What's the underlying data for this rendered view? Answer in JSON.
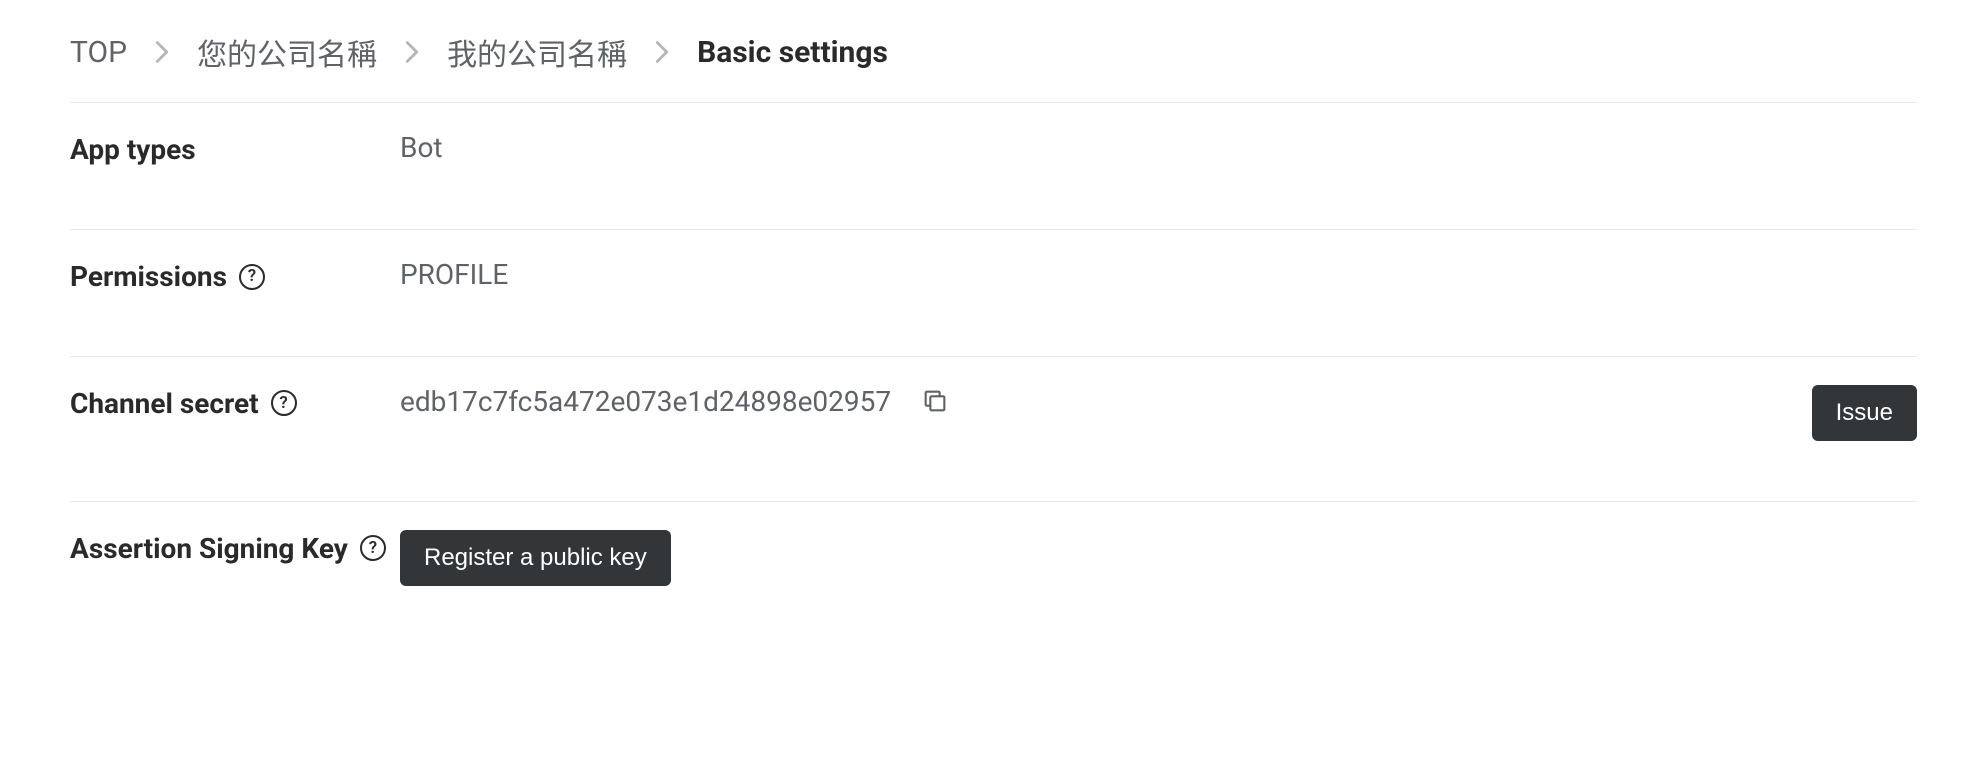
{
  "breadcrumb": {
    "items": [
      {
        "label": "TOP"
      },
      {
        "label": "您的公司名稱"
      },
      {
        "label": "我的公司名稱"
      },
      {
        "label": "Basic settings"
      }
    ]
  },
  "rows": {
    "app_types": {
      "label": "App types",
      "value": "Bot"
    },
    "permissions": {
      "label": "Permissions",
      "value": "PROFILE"
    },
    "channel_secret": {
      "label": "Channel secret",
      "value": "edb17c7fc5a472e073e1d24898e02957",
      "issue_btn": "Issue"
    },
    "assertion_key": {
      "label": "Assertion Signing Key",
      "register_btn": "Register a public key"
    }
  }
}
